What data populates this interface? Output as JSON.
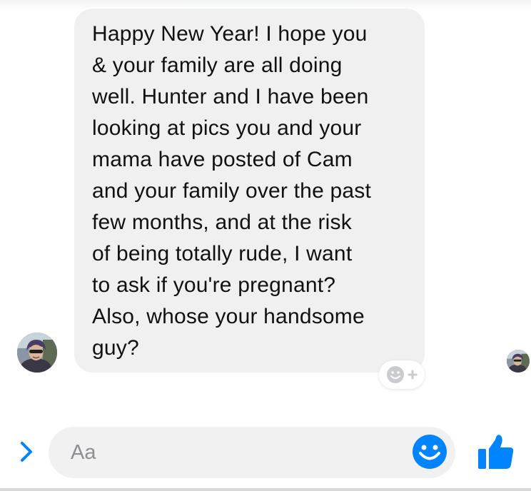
{
  "message": {
    "lines": [
      "Happy New Year! I hope you",
      "& your family are all doing",
      "well. Hunter and I have been",
      "looking at pics you and your",
      "mama have posted of Cam",
      "and your family over the past",
      "few months, and at the risk",
      "of being totally rude, I want",
      "to ask if you're pregnant?",
      "Also, whose your handsome",
      "guy?"
    ]
  },
  "composer": {
    "placeholder": "Aa"
  },
  "icons": {
    "expand": "chevron-right-icon",
    "emoji": "smiley-icon",
    "like": "thumbs-up-icon",
    "reaction": "add-reaction-icon"
  },
  "colors": {
    "accent": "#0084ff",
    "bubble": "#f0f0f0",
    "input_bg": "#f1f1f1",
    "placeholder": "#8e8e93",
    "text": "#111111"
  }
}
